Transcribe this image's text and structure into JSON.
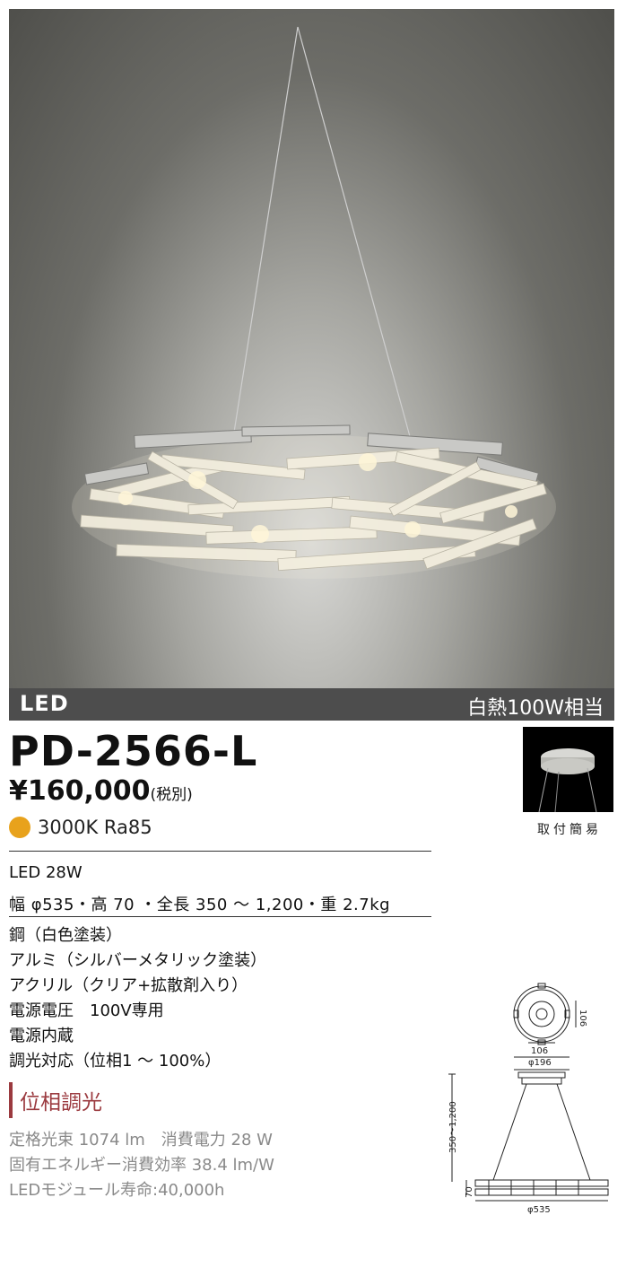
{
  "header_bar": {
    "light_source": "LED",
    "equivalent": "白熱100W相当"
  },
  "product": {
    "model": "PD-2566-L",
    "price": "¥160,000",
    "tax_note": "(税別)",
    "color_temp": "3000K Ra85",
    "color_temp_dot_color": "#e8a21c"
  },
  "specs": {
    "power": "LED 28W",
    "dimensions": "幅 φ535・高 70 ・全長 350 ～ 1,200・重 2.7kg",
    "materials": [
      "鋼（白色塗装）",
      "アルミ（シルバーメタリック塗装）",
      "アクリル（クリア+拡散剤入り）",
      "電源電圧　100V専用",
      "電源内蔵",
      "調光対応（位相1 ～ 100%）"
    ],
    "dimming_badge": "位相調光",
    "performance": [
      "定格光束 1074 lm　消費電力 28 W",
      "固有エネルギー消費効率 38.4 lm/W",
      "LEDモジュール寿命:40,000h"
    ]
  },
  "install_thumb": {
    "caption": "取付簡易"
  },
  "drawing": {
    "top_dim_right": "106",
    "top_dim_bottom": "106",
    "canopy_dia": "φ196",
    "length": "350～1,200",
    "height": "70",
    "width": "φ535"
  }
}
